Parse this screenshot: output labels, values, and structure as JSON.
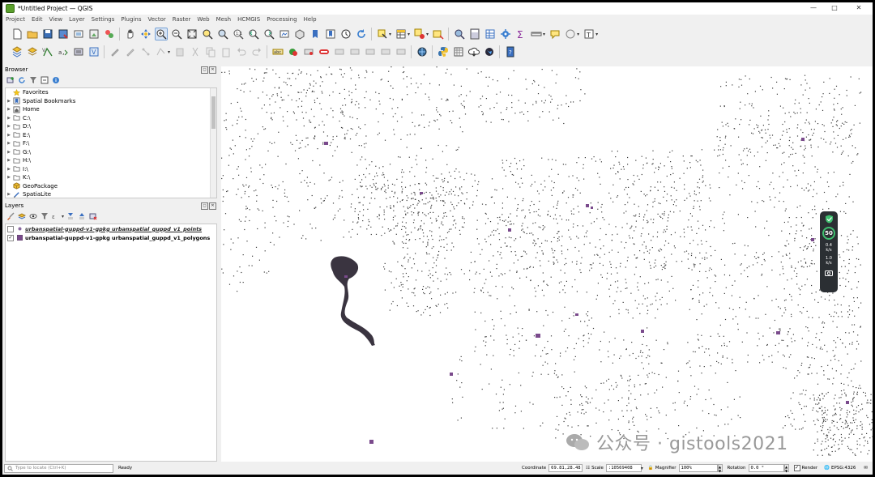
{
  "window": {
    "title": "*Untitled Project — QGIS",
    "controls": [
      "minimize",
      "maximize",
      "close"
    ]
  },
  "menubar": [
    "Project",
    "Edit",
    "View",
    "Layer",
    "Settings",
    "Plugins",
    "Vector",
    "Raster",
    "Web",
    "Mesh",
    "HCMGIS",
    "Processing",
    "Help"
  ],
  "browser": {
    "title": "Browser",
    "items": [
      {
        "label": "Favorites",
        "icon": "star-icon",
        "expandable": false
      },
      {
        "label": "Spatial Bookmarks",
        "icon": "bookmark-icon",
        "expandable": true
      },
      {
        "label": "Home",
        "icon": "home-icon",
        "expandable": true
      },
      {
        "label": "C:\\",
        "icon": "folder-icon",
        "expandable": true
      },
      {
        "label": "D:\\",
        "icon": "folder-icon",
        "expandable": true
      },
      {
        "label": "E:\\",
        "icon": "folder-icon",
        "expandable": true
      },
      {
        "label": "F:\\",
        "icon": "folder-icon",
        "expandable": true
      },
      {
        "label": "G:\\",
        "icon": "folder-icon",
        "expandable": true
      },
      {
        "label": "H:\\",
        "icon": "folder-icon",
        "expandable": true
      },
      {
        "label": "I:\\",
        "icon": "folder-icon",
        "expandable": true
      },
      {
        "label": "K:\\",
        "icon": "folder-icon",
        "expandable": true
      },
      {
        "label": "GeoPackage",
        "icon": "geopackage-icon",
        "expandable": false
      },
      {
        "label": "SpatiaLite",
        "icon": "spatialite-icon",
        "expandable": true
      }
    ]
  },
  "layers": {
    "title": "Layers",
    "items": [
      {
        "label": "urbanspatial-guppd-v1-gpkg urbanspatial_guppd_v1_points",
        "checked": false,
        "symbol_color": "#8a6aa0"
      },
      {
        "label": "urbanspatial-guppd-v1-gpkg urbanspatial_guppd_v1_polygons",
        "checked": true,
        "symbol_color": "#7a4a8c"
      }
    ]
  },
  "perf_widget": {
    "value": "50",
    "stat1_value": "0.4",
    "stat1_unit": "k/s",
    "stat2_value": "1.0",
    "stat2_unit": "k/s",
    "accent": "#3fbf6f"
  },
  "watermark": "公众号 · gistools2021",
  "statusbar": {
    "locate_placeholder": "Type to locate (Ctrl+K)",
    "ready": "Ready",
    "coordinate_label": "Coordinate",
    "coordinate_value": "69.81,28.48",
    "scale_label": "Scale",
    "scale_value": ":10569408",
    "magnifier_label": "Magnifier",
    "magnifier_value": "100%",
    "rotation_label": "Rotation",
    "rotation_value": "0.0 °",
    "render_label": "Render",
    "render_checked": true,
    "crs": "EPSG:4326"
  },
  "colors": {
    "polygon_fill": "#7a4a8c",
    "point_dots": "#3a3a3a",
    "canvas_bg": "#ffffff"
  }
}
